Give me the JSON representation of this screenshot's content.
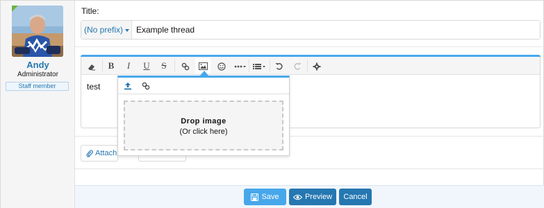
{
  "user": {
    "name": "Andy",
    "title": "Administrator",
    "badge": "Staff member"
  },
  "thread": {
    "title_label": "Title:",
    "prefix_label": "(No prefix)",
    "title_value": "Example thread"
  },
  "editor": {
    "content": "test",
    "toolbar_icons": [
      "eraser-icon",
      "bold-icon",
      "italic-icon",
      "underline-icon",
      "strikethrough-icon",
      "link-icon",
      "image-icon",
      "smiley-icon",
      "more-icon",
      "list-icon",
      "undo-icon",
      "redo-icon",
      "gear-icon"
    ],
    "toolbar_glyphs": {
      "bold": "B",
      "italic": "I",
      "underline": "U",
      "strike": "S"
    }
  },
  "image_popup": {
    "drop_title": "Drop image",
    "drop_subtitle": "(Or click here)"
  },
  "attach": {
    "label": "Attach"
  },
  "footer": {
    "save_label": "Save",
    "preview_label": "Preview",
    "cancel_label": "Cancel"
  },
  "colors": {
    "accent": "#47a7eb",
    "primary": "#2577b1",
    "badge_green": "#6cb33f"
  }
}
